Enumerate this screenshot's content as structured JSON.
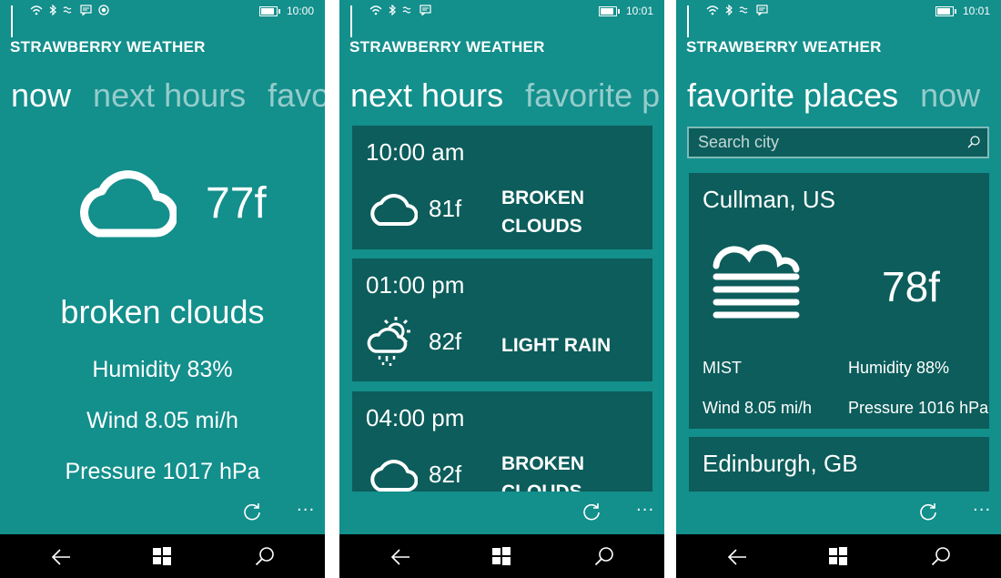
{
  "status": {
    "time_1": "10:00",
    "time_2": "10:01",
    "time_3": "10:01"
  },
  "app": {
    "title": "STRAWBERRY WEATHER"
  },
  "pivots": {
    "now": "now",
    "next_hours": "next hours",
    "favorite_places": "favorite places",
    "fav_trunc": "favo",
    "favorite_trunc": "favorite p"
  },
  "now": {
    "icon": "cloud-icon",
    "temperature": "77f",
    "description": "broken clouds",
    "humidity": "Humidity 83%",
    "wind": "Wind 8.05 mi/h",
    "pressure": "Pressure 1017 hPa"
  },
  "next_hours": [
    {
      "time": "10:00 am",
      "icon": "cloud-icon",
      "temperature": "81f",
      "description": "BROKEN CLOUDS"
    },
    {
      "time": "01:00 pm",
      "icon": "sun-rain-icon",
      "temperature": "82f",
      "description": "LIGHT RAIN"
    },
    {
      "time": "04:00 pm",
      "icon": "cloud-icon",
      "temperature": "82f",
      "description": "BROKEN CLOUDS"
    }
  ],
  "favorites": {
    "search_placeholder": "Search city",
    "places": [
      {
        "name": "Cullman, US",
        "icon": "mist-icon",
        "temperature": "78f",
        "condition": "MIST",
        "humidity": "Humidity 88%",
        "wind": "Wind 8.05 mi/h",
        "pressure": "Pressure 1016 hPa"
      },
      {
        "name": "Edinburgh, GB"
      }
    ]
  },
  "appbar": {
    "more": "···"
  },
  "colors": {
    "background": "#138f8c",
    "card": "#0c5d5b",
    "navbar": "#000000"
  }
}
